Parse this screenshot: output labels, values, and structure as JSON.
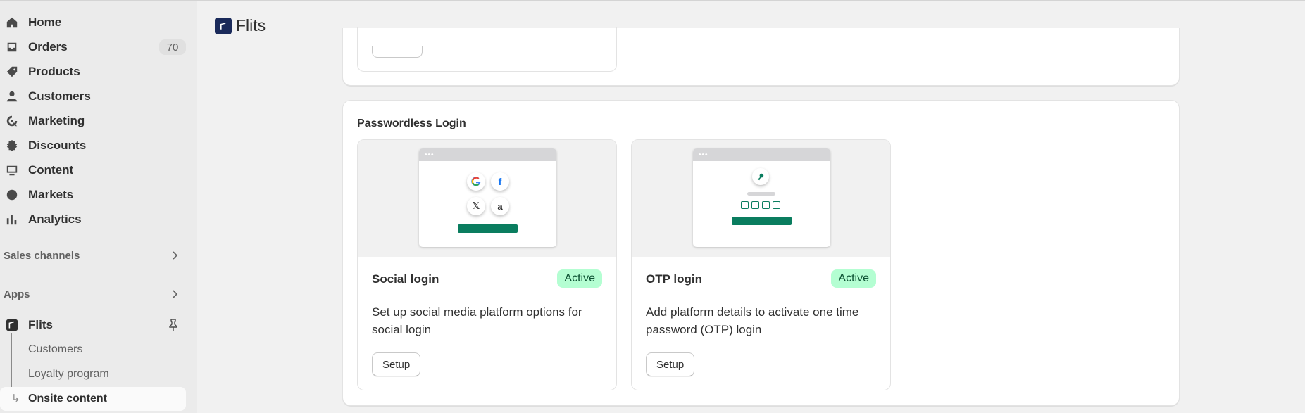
{
  "sidebar": {
    "items": [
      {
        "label": "Home",
        "icon": "home-icon"
      },
      {
        "label": "Orders",
        "icon": "orders-icon",
        "badge": "70"
      },
      {
        "label": "Products",
        "icon": "tag-icon"
      },
      {
        "label": "Customers",
        "icon": "person-icon"
      },
      {
        "label": "Marketing",
        "icon": "target-icon"
      },
      {
        "label": "Discounts",
        "icon": "discount-icon"
      },
      {
        "label": "Content",
        "icon": "content-icon"
      },
      {
        "label": "Markets",
        "icon": "globe-icon"
      },
      {
        "label": "Analytics",
        "icon": "chart-bars-icon"
      }
    ],
    "sales_channels_label": "Sales channels",
    "apps_label": "Apps",
    "app": {
      "label": "Flits",
      "sub_items": [
        "Customers",
        "Loyalty program",
        "Onsite content"
      ]
    }
  },
  "header": {
    "title": "Flits"
  },
  "main": {
    "section_title": "Passwordless Login",
    "tiles": [
      {
        "name": "Social login",
        "status": "Active",
        "description": "Set up social media platform options for social login",
        "button": "Setup"
      },
      {
        "name": "OTP login",
        "status": "Active",
        "description": "Add platform details to activate one time password (OTP) login",
        "button": "Setup"
      }
    ]
  },
  "colors": {
    "accent_green": "#0a7d5f",
    "status_bg": "#b4fed2",
    "status_text": "#0c5132",
    "sidebar_bg": "#ebebeb"
  }
}
